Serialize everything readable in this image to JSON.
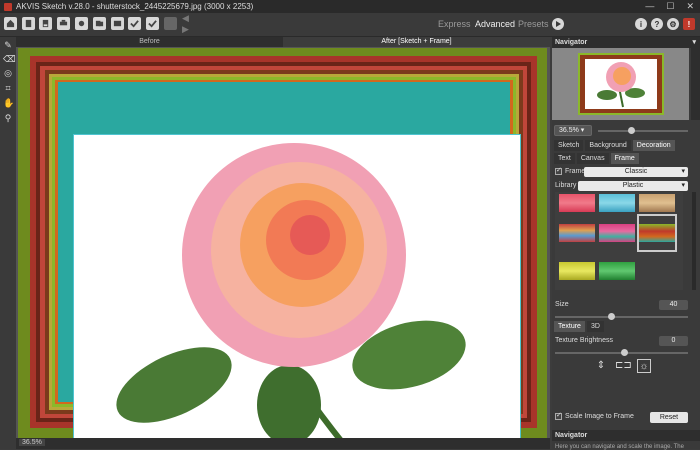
{
  "window": {
    "title": "AKVIS Sketch v.28.0 - shutterstock_2445225679.jpg (3000 x 2253)",
    "controls": [
      "—",
      "☐",
      "✕"
    ]
  },
  "toolbar": {
    "icons": [
      "home-icon",
      "open-icon",
      "save-icon",
      "print-icon",
      "share-icon",
      "batch-icon",
      "preferences-icon",
      "apply-icon",
      "check-icon",
      "undo-icon",
      "redo-icon"
    ],
    "modes": [
      "Express",
      "Advanced",
      "Presets"
    ],
    "active_mode": "Advanced",
    "right_icons": [
      "i",
      "?",
      "⚙",
      "!"
    ]
  },
  "left_tools": [
    "✎",
    "⌫",
    "◎",
    "⌗",
    "✋",
    "⚲"
  ],
  "view_tabs": {
    "before": "Before",
    "after": "After [Sketch + Frame]"
  },
  "status": {
    "zoom": "36.5%"
  },
  "navigator": {
    "title": "Navigator",
    "zoom": "36.5%"
  },
  "settings_tabs": [
    "Sketch",
    "Background",
    "Decoration"
  ],
  "decoration_tabs": [
    "Text",
    "Canvas",
    "Frame"
  ],
  "frame": {
    "label": "Frame",
    "style": "Classic",
    "library_label": "Library",
    "library": "Plastic"
  },
  "size": {
    "label": "Size",
    "value": "40"
  },
  "texture_tabs": [
    "Texture",
    "3D"
  ],
  "texture_brightness": {
    "label": "Texture Brightness",
    "value": "0"
  },
  "scale": {
    "label": "Scale Image to Frame",
    "reset": "Reset"
  },
  "help": {
    "title": "Navigator",
    "text": "Here you can navigate and scale the image. The"
  },
  "colors": {
    "accent": "#6e8b1e",
    "frame_red": "#a8342a"
  }
}
